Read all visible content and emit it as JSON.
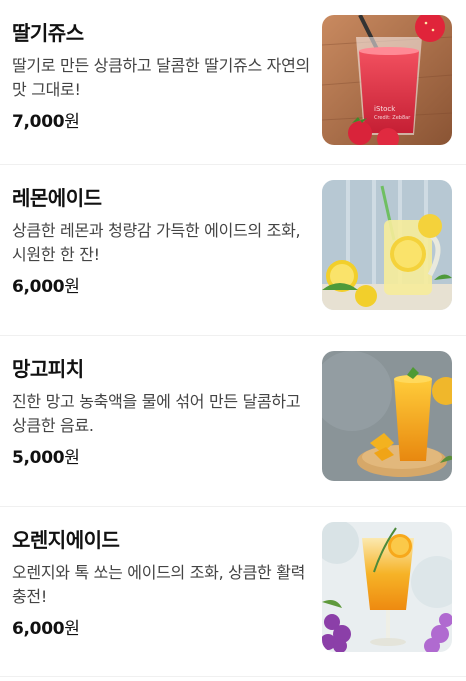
{
  "menu_items": [
    {
      "name": "딸기쥬스",
      "description": "딸기로 만든 상큼하고 달콤한 딸기쥬스 자연의 맛 그대로!",
      "price": "7,000",
      "currency": "원",
      "image_watermark": "iStock\nCredit: Zeb8ar",
      "image_icon": "strawberry-juice-photo"
    },
    {
      "name": "레몬에이드",
      "description": "상큼한 레몬과 청량감 가득한 에이드의 조화, 시원한 한 잔!",
      "price": "6,000",
      "currency": "원",
      "image_icon": "lemonade-photo"
    },
    {
      "name": "망고피치",
      "description": "진한 망고 농축액을 물에 섞어 만든 달콤하고 상큼한 음료.",
      "price": "5,000",
      "currency": "원",
      "image_icon": "mango-peach-photo"
    },
    {
      "name": "오렌지에이드",
      "description": "오렌지와 톡 쏘는 에이드의 조화, 상큼한 활력 충전!",
      "price": "6,000",
      "currency": "원",
      "image_icon": "orangeade-photo"
    }
  ]
}
